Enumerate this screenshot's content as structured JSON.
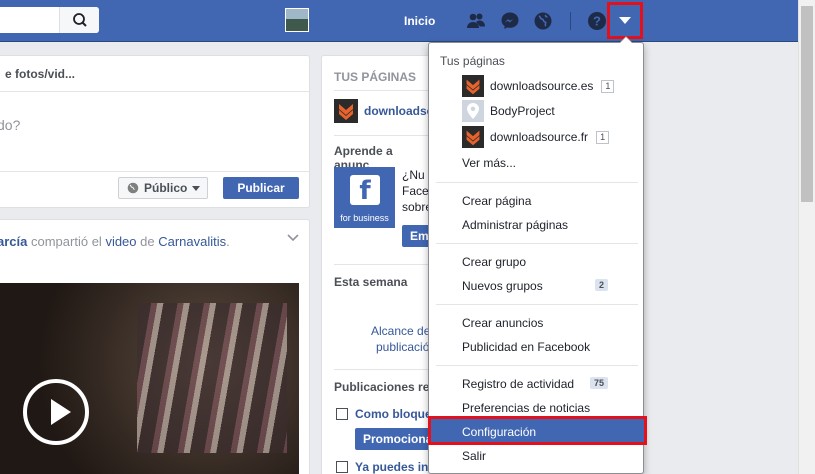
{
  "topbar": {
    "home_label": "Inicio"
  },
  "composer": {
    "tab_label": "e fotos/vid...",
    "prompt": "do?",
    "audience_label": "Público",
    "publish_label": "Publicar"
  },
  "post": {
    "author": "arcía",
    "shared_text": "compartió el",
    "video_link": "video",
    "de_text": "de",
    "page_link": "Carnavalitis",
    "period": "."
  },
  "right_column": {
    "your_pages_label": "TUS PÁGINAS",
    "page_name": "downloadsc",
    "learn_label": "Aprende a anunc",
    "fb_business": "for business",
    "promo_line1": "¿Nu",
    "promo_line2": "Face",
    "promo_line3": "sobre",
    "promo_btn": "Em",
    "week_label": "Esta semana",
    "reach_line1": "Alcance de",
    "reach_line2": "publicació",
    "posts_label": "Publicaciones re",
    "post1_text": "Como bloque",
    "promote_btn": "Promociona",
    "post2_text": "Ya puedes in"
  },
  "menu": {
    "header": "Tus páginas",
    "pages": [
      {
        "name": "downloadsource.es",
        "count": "1"
      },
      {
        "name": "BodyProject",
        "count": ""
      },
      {
        "name": "downloadsource.fr",
        "count": "1"
      }
    ],
    "see_more": "Ver más...",
    "create_page": "Crear página",
    "manage_pages": "Administrar páginas",
    "create_group": "Crear grupo",
    "new_groups": "Nuevos grupos",
    "new_groups_count": "2",
    "create_ads": "Crear anuncios",
    "fb_ads": "Publicidad en Facebook",
    "activity_log": "Registro de actividad",
    "activity_count": "75",
    "news_prefs": "Preferencias de noticias",
    "settings": "Configuración",
    "logout": "Salir"
  },
  "colors": {
    "brand": "#4267b2",
    "highlight": "#e4101c"
  }
}
